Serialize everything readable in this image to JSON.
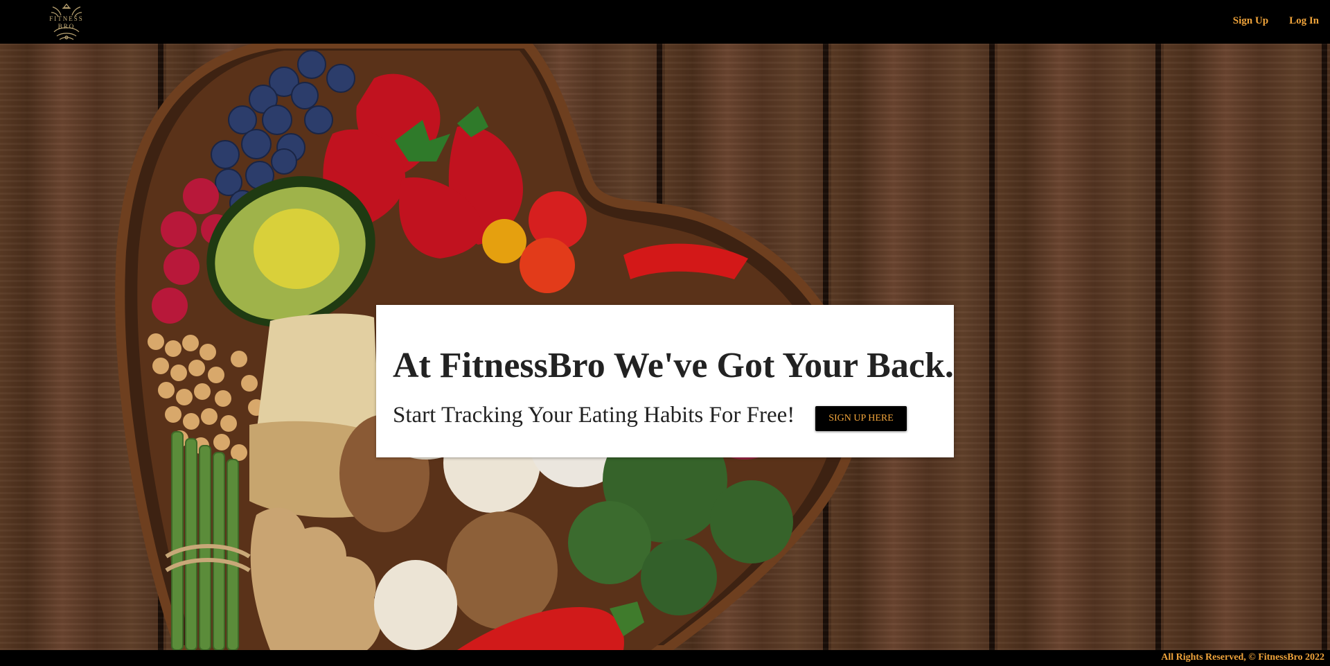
{
  "header": {
    "logo_text_line1": "FITNESS",
    "logo_text_line2": "BRO",
    "nav": {
      "signup_label": "Sign Up",
      "login_label": "Log In"
    }
  },
  "hero": {
    "headline": "At FitnessBro We've Got Your Back.",
    "subline": "Start Tracking Your Eating Habits For Free!",
    "cta_label": "SIGN UP HERE"
  },
  "footer": {
    "text": "All Rights Reserved, © FitnessBro 2022"
  },
  "colors": {
    "accent": "#f0a43b",
    "header_bg": "#000000",
    "card_bg": "#ffffff",
    "text": "#222222"
  },
  "icons": {
    "logo": "fitnessbro-crest-logo"
  }
}
